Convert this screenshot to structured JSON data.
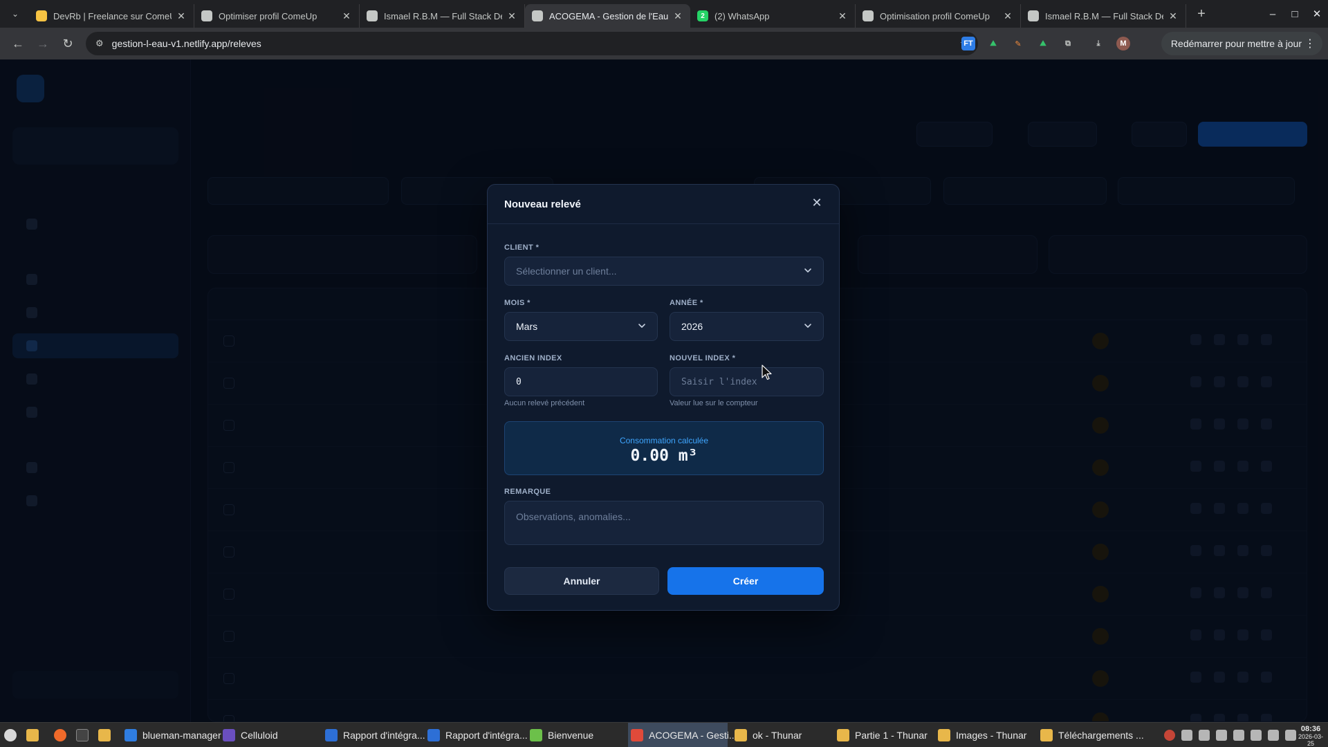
{
  "browser": {
    "tabs": [
      {
        "title": "DevRb | Freelance sur ComeUp",
        "favicon_color": "#f6c343",
        "favicon_text": "",
        "active": false
      },
      {
        "title": "Optimiser profil ComeUp",
        "favicon_color": "#c4c7c5",
        "favicon_text": "",
        "active": false
      },
      {
        "title": "Ismael R.B.M — Full Stack Dev",
        "favicon_color": "#c4c7c5",
        "favicon_text": "",
        "active": false
      },
      {
        "title": "ACOGEMA - Gestion de l'Eau",
        "favicon_color": "#c4c7c5",
        "favicon_text": "",
        "active": true
      },
      {
        "title": "(2) WhatsApp",
        "favicon_color": "#25d366",
        "favicon_text": "2",
        "active": false
      },
      {
        "title": "Optimisation profil ComeUp",
        "favicon_color": "#c4c7c5",
        "favicon_text": "",
        "active": false
      },
      {
        "title": "Ismael R.B.M — Full Stack Dev",
        "favicon_color": "#c4c7c5",
        "favicon_text": "",
        "active": false
      }
    ],
    "url": "gestion-l-eau-v1.netlify.app/releves",
    "restart_label": "Redémarrer pour mettre à jour",
    "profile_initial": "M"
  },
  "modal": {
    "title": "Nouveau relevé",
    "client_label": "CLIENT *",
    "client_placeholder": "Sélectionner un client...",
    "mois_label": "MOIS *",
    "mois_value": "Mars",
    "annee_label": "ANNÉE *",
    "annee_value": "2026",
    "ancien_label": "ANCIEN INDEX",
    "ancien_value": "0",
    "ancien_hint": "Aucun relevé précédent",
    "nouvel_label": "NOUVEL INDEX *",
    "nouvel_placeholder": "Saisir l'index",
    "nouvel_hint": "Valeur lue sur le compteur",
    "conso_label": "Consommation calculée",
    "conso_value": "0.00 m³",
    "remarque_label": "REMARQUE",
    "remarque_placeholder": "Observations, anomalies...",
    "cancel_label": "Annuler",
    "create_label": "Créer"
  },
  "taskbar": {
    "items": [
      {
        "label": "blueman-manager",
        "color": "#2f7de1"
      },
      {
        "label": "Celluloid",
        "color": "#6a4fbf"
      },
      {
        "label": "Rapport d'intégra...",
        "color": "#2d6fd6"
      },
      {
        "label": "Rapport d'intégra...",
        "color": "#2d6fd6"
      },
      {
        "label": "Bienvenue",
        "color": "#6cc04a"
      },
      {
        "label": "ACOGEMA - Gesti...",
        "color": "#e04a3a"
      },
      {
        "label": "ok - Thunar",
        "color": "#e8b74a"
      },
      {
        "label": "Partie 1 - Thunar",
        "color": "#e8b74a"
      },
      {
        "label": "Images - Thunar",
        "color": "#e8b74a"
      },
      {
        "label": "Téléchargements ...",
        "color": "#e8b74a"
      }
    ],
    "time": "08:36",
    "date": "2026-03-25"
  },
  "colors": {
    "accent": "#1673ea",
    "conso_label": "#3fa6ff",
    "pending_badge": "#f0a826"
  }
}
